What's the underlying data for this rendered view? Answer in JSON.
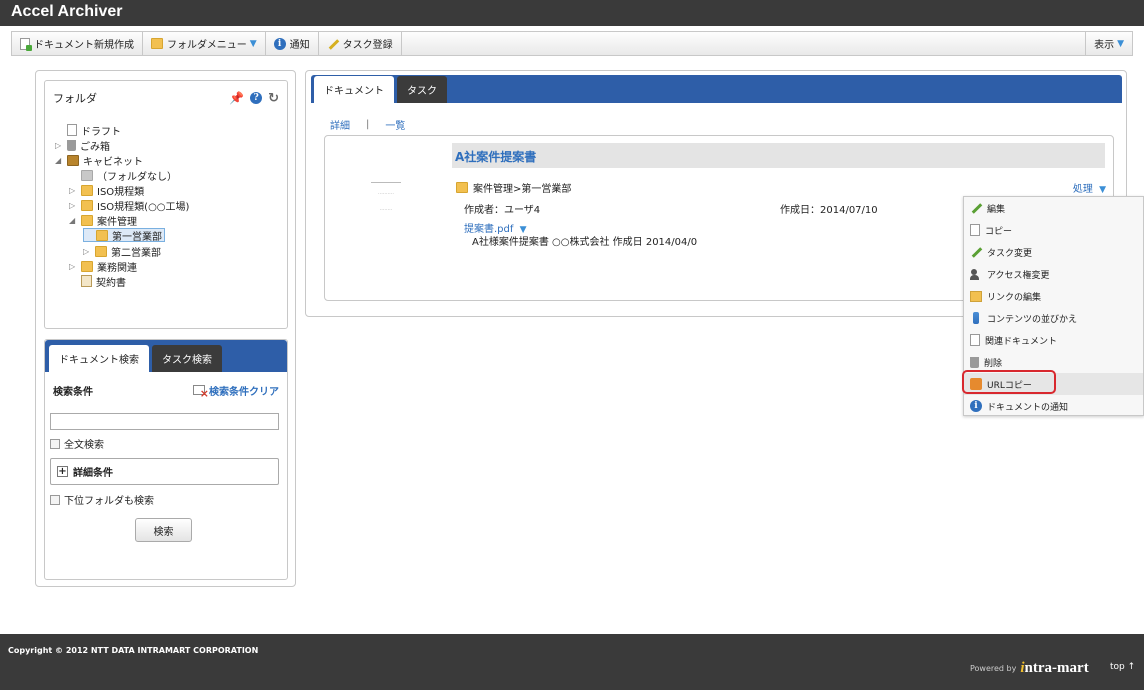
{
  "app": {
    "title": "Accel Archiver"
  },
  "toolbar": {
    "new_doc": "ドキュメント新規作成",
    "folder_menu": "フォルダメニュー",
    "notify": "通知",
    "task_register": "タスク登録",
    "view": "表示"
  },
  "folder_panel": {
    "title": "フォルダ",
    "items": [
      {
        "label": "ドラフト"
      },
      {
        "label": "ごみ箱"
      },
      {
        "label": "キャビネット"
      },
      {
        "label": "（フォルダなし）"
      },
      {
        "label": "ISO規程類"
      },
      {
        "label": "ISO規程類(○○工場)"
      },
      {
        "label": "案件管理"
      },
      {
        "label": "第一営業部"
      },
      {
        "label": "第二営業部"
      },
      {
        "label": "業務関連"
      },
      {
        "label": "契約書"
      }
    ]
  },
  "search_panel": {
    "tab_doc": "ドキュメント検索",
    "tab_task": "タスク検索",
    "condition_label": "検索条件",
    "clear_label": "検索条件クリア",
    "input_value": "",
    "fulltext_label": "全文検索",
    "detail_label": "詳細条件",
    "subfolder_label": "下位フォルダも検索",
    "search_button": "検索"
  },
  "main": {
    "tab_doc": "ドキュメント",
    "tab_task": "タスク",
    "link_detail": "詳細",
    "link_list": "一覧",
    "card": {
      "title": "A社案件提案書",
      "path": "案件管理>第一営業部",
      "action": "処理",
      "creator": "作成者：ユーザ4",
      "created": "作成日：2014/07/10",
      "file": "提案書.pdf",
      "description": "A社様案件提案書 ○○株式会社 作成日 2014/04/0"
    }
  },
  "menu": {
    "items": [
      {
        "label": "編集",
        "icon": "pencil-icon"
      },
      {
        "label": "コピー",
        "icon": "copy-icon"
      },
      {
        "label": "タスク変更",
        "icon": "pencil-icon"
      },
      {
        "label": "アクセス権変更",
        "icon": "users-icon"
      },
      {
        "label": "リンクの編集",
        "icon": "link-icon"
      },
      {
        "label": "コンテンツの並びかえ",
        "icon": "sort-icon"
      },
      {
        "label": "関連ドキュメント",
        "icon": "related-doc-icon"
      },
      {
        "label": "削除",
        "icon": "trash-icon"
      },
      {
        "label": "URLコピー",
        "icon": "url-copy-icon"
      },
      {
        "label": "ドキュメントの通知",
        "icon": "info-icon"
      }
    ],
    "highlight_color": "#d8282e"
  },
  "footer": {
    "copyright": "Copyright © 2012 NTT DATA INTRAMART CORPORATION",
    "powered": "Powered by",
    "brand": "ntra-mart",
    "brand_i": "i",
    "top": "top ↑"
  }
}
